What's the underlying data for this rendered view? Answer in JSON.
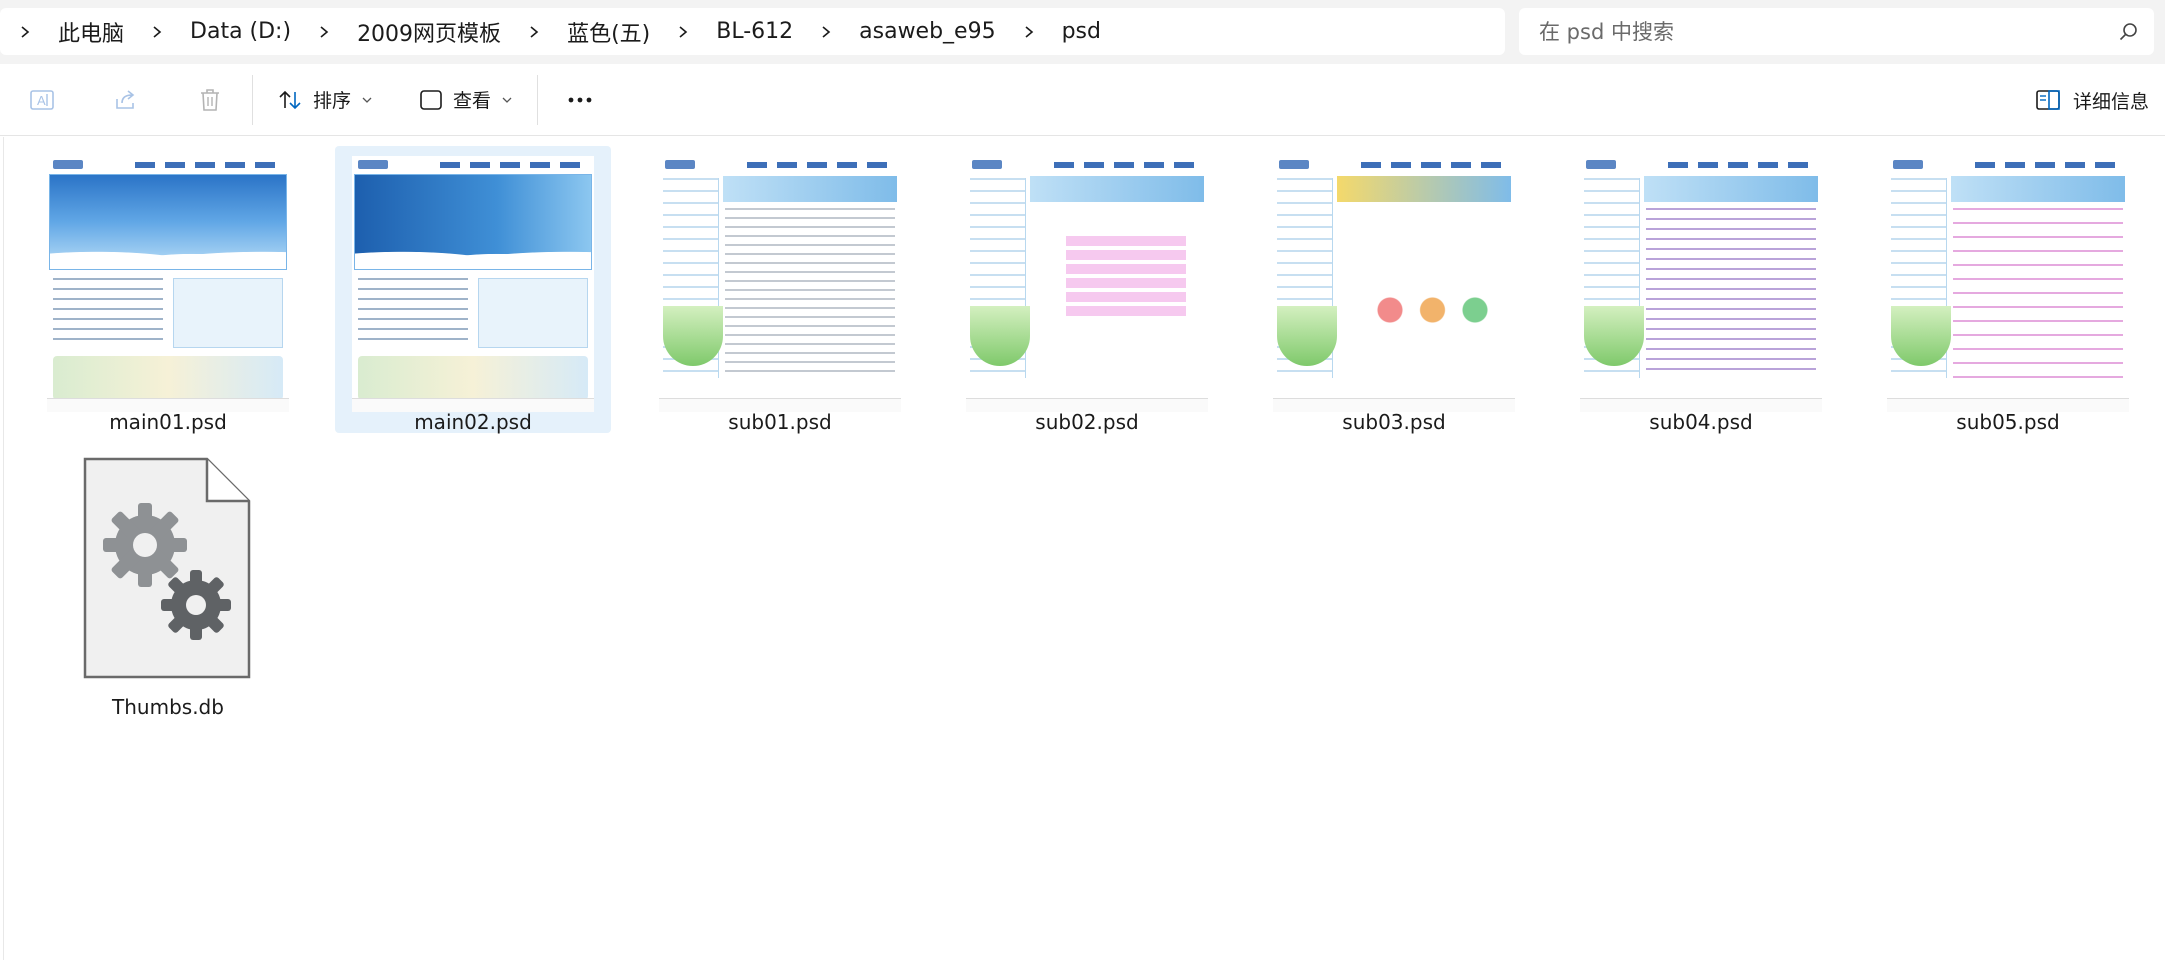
{
  "address_bar": {
    "breadcrumbs": [
      "此电脑",
      "Data (D:)",
      "2009网页模板",
      "蓝色(五)",
      "BL-612",
      "asaweb_e95",
      "psd"
    ],
    "search_placeholder": "在 psd 中搜索"
  },
  "toolbar": {
    "sort_label": "排序",
    "view_label": "查看",
    "more_label": "...",
    "details_label": "详细信息"
  },
  "files": [
    {
      "name": "main01.psd",
      "selected": false
    },
    {
      "name": "main02.psd",
      "selected": true
    },
    {
      "name": "sub01.psd",
      "selected": false
    },
    {
      "name": "sub02.psd",
      "selected": false
    },
    {
      "name": "sub03.psd",
      "selected": false
    },
    {
      "name": "sub04.psd",
      "selected": false
    },
    {
      "name": "sub05.psd",
      "selected": false
    },
    {
      "name": "Thumbs.db",
      "selected": false
    }
  ],
  "colors": {
    "selection": "#e5f1fb",
    "accent": "#0067c0"
  }
}
